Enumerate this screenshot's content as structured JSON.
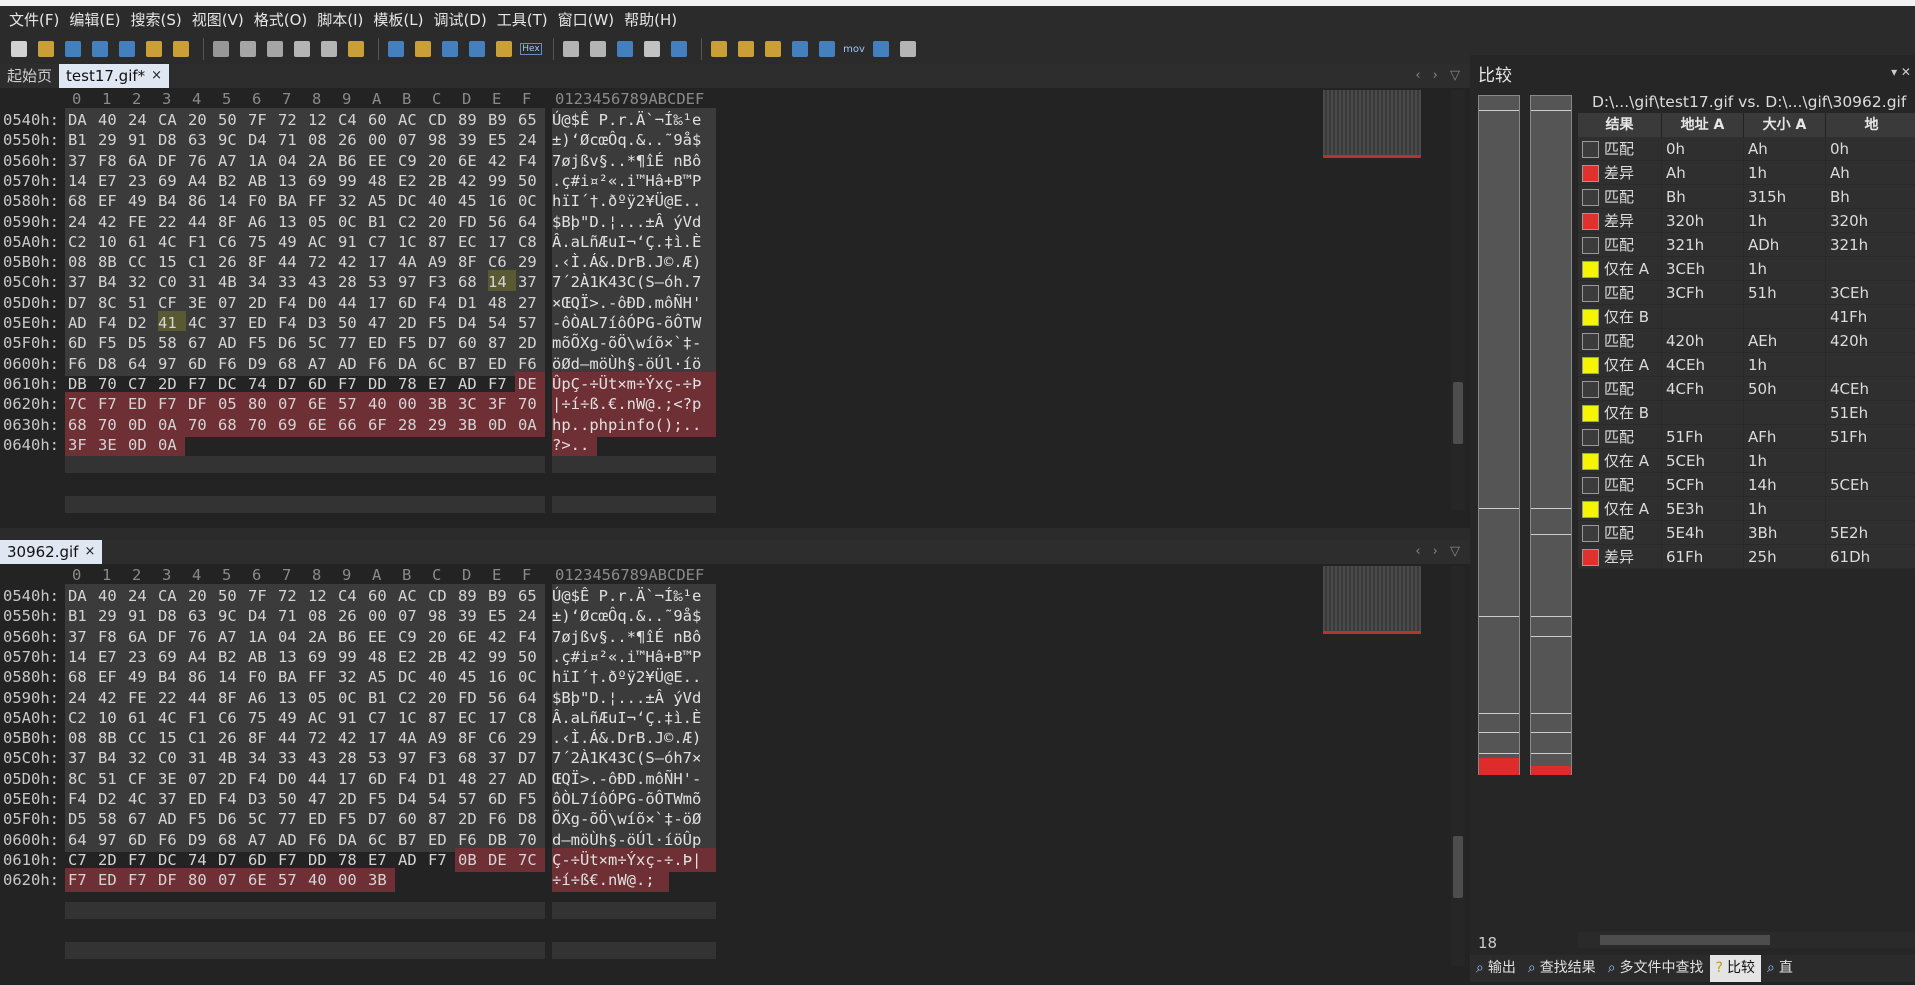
{
  "menu": [
    "文件(F)",
    "编辑(E)",
    "搜索(S)",
    "视图(V)",
    "格式(O)",
    "脚本(I)",
    "模板(L)",
    "调试(D)",
    "工具(T)",
    "窗口(W)",
    "帮助(H)"
  ],
  "toolbar_icons": [
    "new-file-icon",
    "open-icon",
    "save-icon",
    "save-as-icon",
    "save-all-icon",
    "open-folder-icon",
    "open-folders-icon",
    "cut-icon",
    "copy-icon",
    "paste-icon",
    "undo-icon",
    "redo-icon",
    "find-icon",
    "find-replace-icon",
    "find-in-files-icon",
    "goto-icon",
    "template-icon",
    "script-icon",
    "hex-mode-icon",
    "text-mode-icon",
    "pilcrow-icon",
    "columns-icon",
    "highlight-icon",
    "calculator-icon",
    "inspector-icon",
    "compare-icon",
    "histogram-icon",
    "checksum-icon",
    "check-icon",
    "mov-icon",
    "convert-icon",
    "pause-icon"
  ],
  "toolbar_labels": {
    "hex": "Hex",
    "mov": "mov"
  },
  "top_editor": {
    "tabs": [
      "起始页",
      "test17.gif*"
    ],
    "active_tab": "test17.gif*",
    "close": "×",
    "arrows": "‹ › ▽",
    "col_header": [
      "0",
      "1",
      "2",
      "3",
      "4",
      "5",
      "6",
      "7",
      "8",
      "9",
      "A",
      "B",
      "C",
      "D",
      "E",
      "F"
    ],
    "ascii_header": "0123456789ABCDEF",
    "rows": [
      {
        "addr": "0540h:",
        "bytes": [
          "DA",
          "40",
          "24",
          "CA",
          "20",
          "50",
          "7F",
          "72",
          "12",
          "C4",
          "60",
          "AC",
          "CD",
          "89",
          "B9",
          "65"
        ],
        "ascii": "Ú@$Ê P.r.Ä`¬Í‰¹e"
      },
      {
        "addr": "0550h:",
        "bytes": [
          "B1",
          "29",
          "91",
          "D8",
          "63",
          "9C",
          "D4",
          "71",
          "08",
          "26",
          "00",
          "07",
          "98",
          "39",
          "E5",
          "24"
        ],
        "ascii": "±)‘ØcœÔq.&..˜9å$"
      },
      {
        "addr": "0560h:",
        "bytes": [
          "37",
          "F8",
          "6A",
          "DF",
          "76",
          "A7",
          "1A",
          "04",
          "2A",
          "B6",
          "EE",
          "C9",
          "20",
          "6E",
          "42",
          "F4"
        ],
        "ascii": "7øjßv§..*¶îÉ nBô"
      },
      {
        "addr": "0570h:",
        "bytes": [
          "14",
          "E7",
          "23",
          "69",
          "A4",
          "B2",
          "AB",
          "13",
          "69",
          "99",
          "48",
          "E2",
          "2B",
          "42",
          "99",
          "50"
        ],
        "ascii": ".ç#i¤²«.i™Hâ+B™P"
      },
      {
        "addr": "0580h:",
        "bytes": [
          "68",
          "EF",
          "49",
          "B4",
          "86",
          "14",
          "F0",
          "BA",
          "FF",
          "32",
          "A5",
          "DC",
          "40",
          "45",
          "16",
          "0C"
        ],
        "ascii": "hïI´†.ðºÿ2¥Ü@E.."
      },
      {
        "addr": "0590h:",
        "bytes": [
          "24",
          "42",
          "FE",
          "22",
          "44",
          "8F",
          "A6",
          "13",
          "05",
          "0C",
          "B1",
          "C2",
          "20",
          "FD",
          "56",
          "64"
        ],
        "ascii": "$Bþ\"D.¦...±Â ýVd"
      },
      {
        "addr": "05A0h:",
        "bytes": [
          "C2",
          "10",
          "61",
          "4C",
          "F1",
          "C6",
          "75",
          "49",
          "AC",
          "91",
          "C7",
          "1C",
          "87",
          "EC",
          "17",
          "C8"
        ],
        "ascii": "Â.aLñÆuI¬‘Ç.‡ì.È"
      },
      {
        "addr": "05B0h:",
        "bytes": [
          "08",
          "8B",
          "CC",
          "15",
          "C1",
          "26",
          "8F",
          "44",
          "72",
          "42",
          "17",
          "4A",
          "A9",
          "8F",
          "C6",
          "29"
        ],
        "ascii": ".‹Ì.Á&.DrB.J©.Æ)"
      },
      {
        "addr": "05C0h:",
        "bytes": [
          "37",
          "B4",
          "32",
          "C0",
          "31",
          "4B",
          "34",
          "33",
          "43",
          "28",
          "53",
          "97",
          "F3",
          "68",
          "14",
          "37"
        ],
        "ascii": "7´2À1K43C(S—óh.7"
      },
      {
        "addr": "05D0h:",
        "bytes": [
          "D7",
          "8C",
          "51",
          "CF",
          "3E",
          "07",
          "2D",
          "F4",
          "D0",
          "44",
          "17",
          "6D",
          "F4",
          "D1",
          "48",
          "27"
        ],
        "ascii": "×ŒQÏ>.-ôÐD.môÑH'"
      },
      {
        "addr": "05E0h:",
        "bytes": [
          "AD",
          "F4",
          "D2",
          "41",
          "4C",
          "37",
          "ED",
          "F4",
          "D3",
          "50",
          "47",
          "2D",
          "F5",
          "D4",
          "54",
          "57"
        ],
        "ascii": "-ôÒAL7íôÓPG-õÔTW"
      },
      {
        "addr": "05F0h:",
        "bytes": [
          "6D",
          "F5",
          "D5",
          "58",
          "67",
          "AD",
          "F5",
          "D6",
          "5C",
          "77",
          "ED",
          "F5",
          "D7",
          "60",
          "87",
          "2D"
        ],
        "ascii": "mõÕXg-õÖ\\wíõ×`‡-"
      },
      {
        "addr": "0600h:",
        "bytes": [
          "F6",
          "D8",
          "64",
          "97",
          "6D",
          "F6",
          "D9",
          "68",
          "A7",
          "AD",
          "F6",
          "DA",
          "6C",
          "B7",
          "ED",
          "F6"
        ],
        "ascii": "öØd—möÙh§-öÚl·íö"
      },
      {
        "addr": "0610h:",
        "bytes": [
          "DB",
          "70",
          "C7",
          "2D",
          "F7",
          "DC",
          "74",
          "D7",
          "6D",
          "F7",
          "DD",
          "78",
          "E7",
          "AD",
          "F7",
          "DE"
        ],
        "ascii": "ÛpÇ-÷Üt×m÷Ýxç-÷Þ"
      },
      {
        "addr": "0620h:",
        "bytes": [
          "7C",
          "F7",
          "ED",
          "F7",
          "DF",
          "05",
          "80",
          "07",
          "6E",
          "57",
          "40",
          "00",
          "3B",
          "3C",
          "3F",
          "70"
        ],
        "ascii": "|÷í÷ß.€.nW@.;<?p"
      },
      {
        "addr": "0630h:",
        "bytes": [
          "68",
          "70",
          "0D",
          "0A",
          "70",
          "68",
          "70",
          "69",
          "6E",
          "66",
          "6F",
          "28",
          "29",
          "3B",
          "0D",
          "0A"
        ],
        "ascii": "hp..phpinfo();.."
      },
      {
        "addr": "0640h:",
        "bytes": [
          "3F",
          "3E",
          "0D",
          "0A"
        ],
        "ascii": "?>.."
      }
    ]
  },
  "bottom_editor": {
    "tab": "30962.gif",
    "close": "×",
    "arrows": "‹ › ▽",
    "col_header": [
      "0",
      "1",
      "2",
      "3",
      "4",
      "5",
      "6",
      "7",
      "8",
      "9",
      "A",
      "B",
      "C",
      "D",
      "E",
      "F"
    ],
    "ascii_header": "0123456789ABCDEF",
    "rows": [
      {
        "addr": "0540h:",
        "bytes": [
          "DA",
          "40",
          "24",
          "CA",
          "20",
          "50",
          "7F",
          "72",
          "12",
          "C4",
          "60",
          "AC",
          "CD",
          "89",
          "B9",
          "65"
        ],
        "ascii": "Ú@$Ê P.r.Ä`¬Í‰¹e"
      },
      {
        "addr": "0550h:",
        "bytes": [
          "B1",
          "29",
          "91",
          "D8",
          "63",
          "9C",
          "D4",
          "71",
          "08",
          "26",
          "00",
          "07",
          "98",
          "39",
          "E5",
          "24"
        ],
        "ascii": "±)‘ØcœÔq.&..˜9å$"
      },
      {
        "addr": "0560h:",
        "bytes": [
          "37",
          "F8",
          "6A",
          "DF",
          "76",
          "A7",
          "1A",
          "04",
          "2A",
          "B6",
          "EE",
          "C9",
          "20",
          "6E",
          "42",
          "F4"
        ],
        "ascii": "7øjßv§..*¶îÉ nBô"
      },
      {
        "addr": "0570h:",
        "bytes": [
          "14",
          "E7",
          "23",
          "69",
          "A4",
          "B2",
          "AB",
          "13",
          "69",
          "99",
          "48",
          "E2",
          "2B",
          "42",
          "99",
          "50"
        ],
        "ascii": ".ç#i¤²«.i™Hâ+B™P"
      },
      {
        "addr": "0580h:",
        "bytes": [
          "68",
          "EF",
          "49",
          "B4",
          "86",
          "14",
          "F0",
          "BA",
          "FF",
          "32",
          "A5",
          "DC",
          "40",
          "45",
          "16",
          "0C"
        ],
        "ascii": "hïI´†.ðºÿ2¥Ü@E.."
      },
      {
        "addr": "0590h:",
        "bytes": [
          "24",
          "42",
          "FE",
          "22",
          "44",
          "8F",
          "A6",
          "13",
          "05",
          "0C",
          "B1",
          "C2",
          "20",
          "FD",
          "56",
          "64"
        ],
        "ascii": "$Bþ\"D.¦...±Â ýVd"
      },
      {
        "addr": "05A0h:",
        "bytes": [
          "C2",
          "10",
          "61",
          "4C",
          "F1",
          "C6",
          "75",
          "49",
          "AC",
          "91",
          "C7",
          "1C",
          "87",
          "EC",
          "17",
          "C8"
        ],
        "ascii": "Â.aLñÆuI¬‘Ç.‡ì.È"
      },
      {
        "addr": "05B0h:",
        "bytes": [
          "08",
          "8B",
          "CC",
          "15",
          "C1",
          "26",
          "8F",
          "44",
          "72",
          "42",
          "17",
          "4A",
          "A9",
          "8F",
          "C6",
          "29"
        ],
        "ascii": ".‹Ì.Á&.DrB.J©.Æ)"
      },
      {
        "addr": "05C0h:",
        "bytes": [
          "37",
          "B4",
          "32",
          "C0",
          "31",
          "4B",
          "34",
          "33",
          "43",
          "28",
          "53",
          "97",
          "F3",
          "68",
          "37",
          "D7"
        ],
        "ascii": "7´2À1K43C(S—óh7×"
      },
      {
        "addr": "05D0h:",
        "bytes": [
          "8C",
          "51",
          "CF",
          "3E",
          "07",
          "2D",
          "F4",
          "D0",
          "44",
          "17",
          "6D",
          "F4",
          "D1",
          "48",
          "27",
          "AD"
        ],
        "ascii": "ŒQÏ>.-ôÐD.môÑH'-"
      },
      {
        "addr": "05E0h:",
        "bytes": [
          "F4",
          "D2",
          "4C",
          "37",
          "ED",
          "F4",
          "D3",
          "50",
          "47",
          "2D",
          "F5",
          "D4",
          "54",
          "57",
          "6D",
          "F5"
        ],
        "ascii": "ôÒL7íôÓPG-õÔTWmõ"
      },
      {
        "addr": "05F0h:",
        "bytes": [
          "D5",
          "58",
          "67",
          "AD",
          "F5",
          "D6",
          "5C",
          "77",
          "ED",
          "F5",
          "D7",
          "60",
          "87",
          "2D",
          "F6",
          "D8"
        ],
        "ascii": "ÕXg-õÖ\\wíõ×`‡-öØ"
      },
      {
        "addr": "0600h:",
        "bytes": [
          "64",
          "97",
          "6D",
          "F6",
          "D9",
          "68",
          "A7",
          "AD",
          "F6",
          "DA",
          "6C",
          "B7",
          "ED",
          "F6",
          "DB",
          "70"
        ],
        "ascii": "d—möÙh§-öÚl·íöÛp"
      },
      {
        "addr": "0610h:",
        "bytes": [
          "C7",
          "2D",
          "F7",
          "DC",
          "74",
          "D7",
          "6D",
          "F7",
          "DD",
          "78",
          "E7",
          "AD",
          "F7",
          "0B",
          "DE",
          "7C"
        ],
        "ascii": "Ç-÷Üt×m÷Ýxç-÷.Þ|"
      },
      {
        "addr": "0620h:",
        "bytes": [
          "F7",
          "ED",
          "F7",
          "DF",
          "80",
          "07",
          "6E",
          "57",
          "40",
          "00",
          "3B"
        ],
        "ascii": "÷í÷ß€.nW@.;"
      }
    ]
  },
  "compare": {
    "title": "比较",
    "pin": "▾ ✕",
    "files": "D:\\...\\gif\\test17.gif   vs.   D:\\...\\gif\\30962.gif",
    "headers": [
      "结果",
      "地址 A",
      "大小 A",
      "地"
    ],
    "rows": [
      {
        "result": "匹配",
        "color": "#3c3c3c",
        "addr": "0h",
        "size": "Ah",
        "b": "0h"
      },
      {
        "result": "差异",
        "color": "#e03030",
        "addr": "Ah",
        "size": "1h",
        "b": "Ah"
      },
      {
        "result": "匹配",
        "color": "#3c3c3c",
        "addr": "Bh",
        "size": "315h",
        "b": "Bh"
      },
      {
        "result": "差异",
        "color": "#e03030",
        "addr": "320h",
        "size": "1h",
        "b": "320h"
      },
      {
        "result": "匹配",
        "color": "#3c3c3c",
        "addr": "321h",
        "size": "ADh",
        "b": "321h"
      },
      {
        "result": "仅在 A",
        "color": "#f5f500",
        "addr": "3CEh",
        "size": "1h",
        "b": ""
      },
      {
        "result": "匹配",
        "color": "#3c3c3c",
        "addr": "3CFh",
        "size": "51h",
        "b": "3CEh"
      },
      {
        "result": "仅在 B",
        "color": "#f5f500",
        "addr": "",
        "size": "",
        "b": "41Fh"
      },
      {
        "result": "匹配",
        "color": "#3c3c3c",
        "addr": "420h",
        "size": "AEh",
        "b": "420h"
      },
      {
        "result": "仅在 A",
        "color": "#f5f500",
        "addr": "4CEh",
        "size": "1h",
        "b": ""
      },
      {
        "result": "匹配",
        "color": "#3c3c3c",
        "addr": "4CFh",
        "size": "50h",
        "b": "4CEh"
      },
      {
        "result": "仅在 B",
        "color": "#f5f500",
        "addr": "",
        "size": "",
        "b": "51Eh"
      },
      {
        "result": "匹配",
        "color": "#3c3c3c",
        "addr": "51Fh",
        "size": "AFh",
        "b": "51Fh"
      },
      {
        "result": "仅在 A",
        "color": "#f5f500",
        "addr": "5CEh",
        "size": "1h",
        "b": ""
      },
      {
        "result": "匹配",
        "color": "#3c3c3c",
        "addr": "5CFh",
        "size": "14h",
        "b": "5CEh"
      },
      {
        "result": "仅在 A",
        "color": "#f5f500",
        "addr": "5E3h",
        "size": "1h",
        "b": ""
      },
      {
        "result": "匹配",
        "color": "#3c3c3c",
        "addr": "5E4h",
        "size": "3Bh",
        "b": "5E2h"
      },
      {
        "result": "差异",
        "color": "#e03030",
        "addr": "61Fh",
        "size": "25h",
        "b": "61Dh"
      }
    ],
    "count": "18"
  },
  "bottom_tabs": [
    "输出",
    "查找结果",
    "多文件中查找",
    "比较",
    "直"
  ],
  "active_bottom_tab": "比较",
  "colors": {
    "diff": "#6e2f35",
    "match_swatch": "#3c3c3c",
    "diff_swatch": "#e03030",
    "only_swatch": "#f5f500",
    "active_tab": "#dfe7f2"
  }
}
